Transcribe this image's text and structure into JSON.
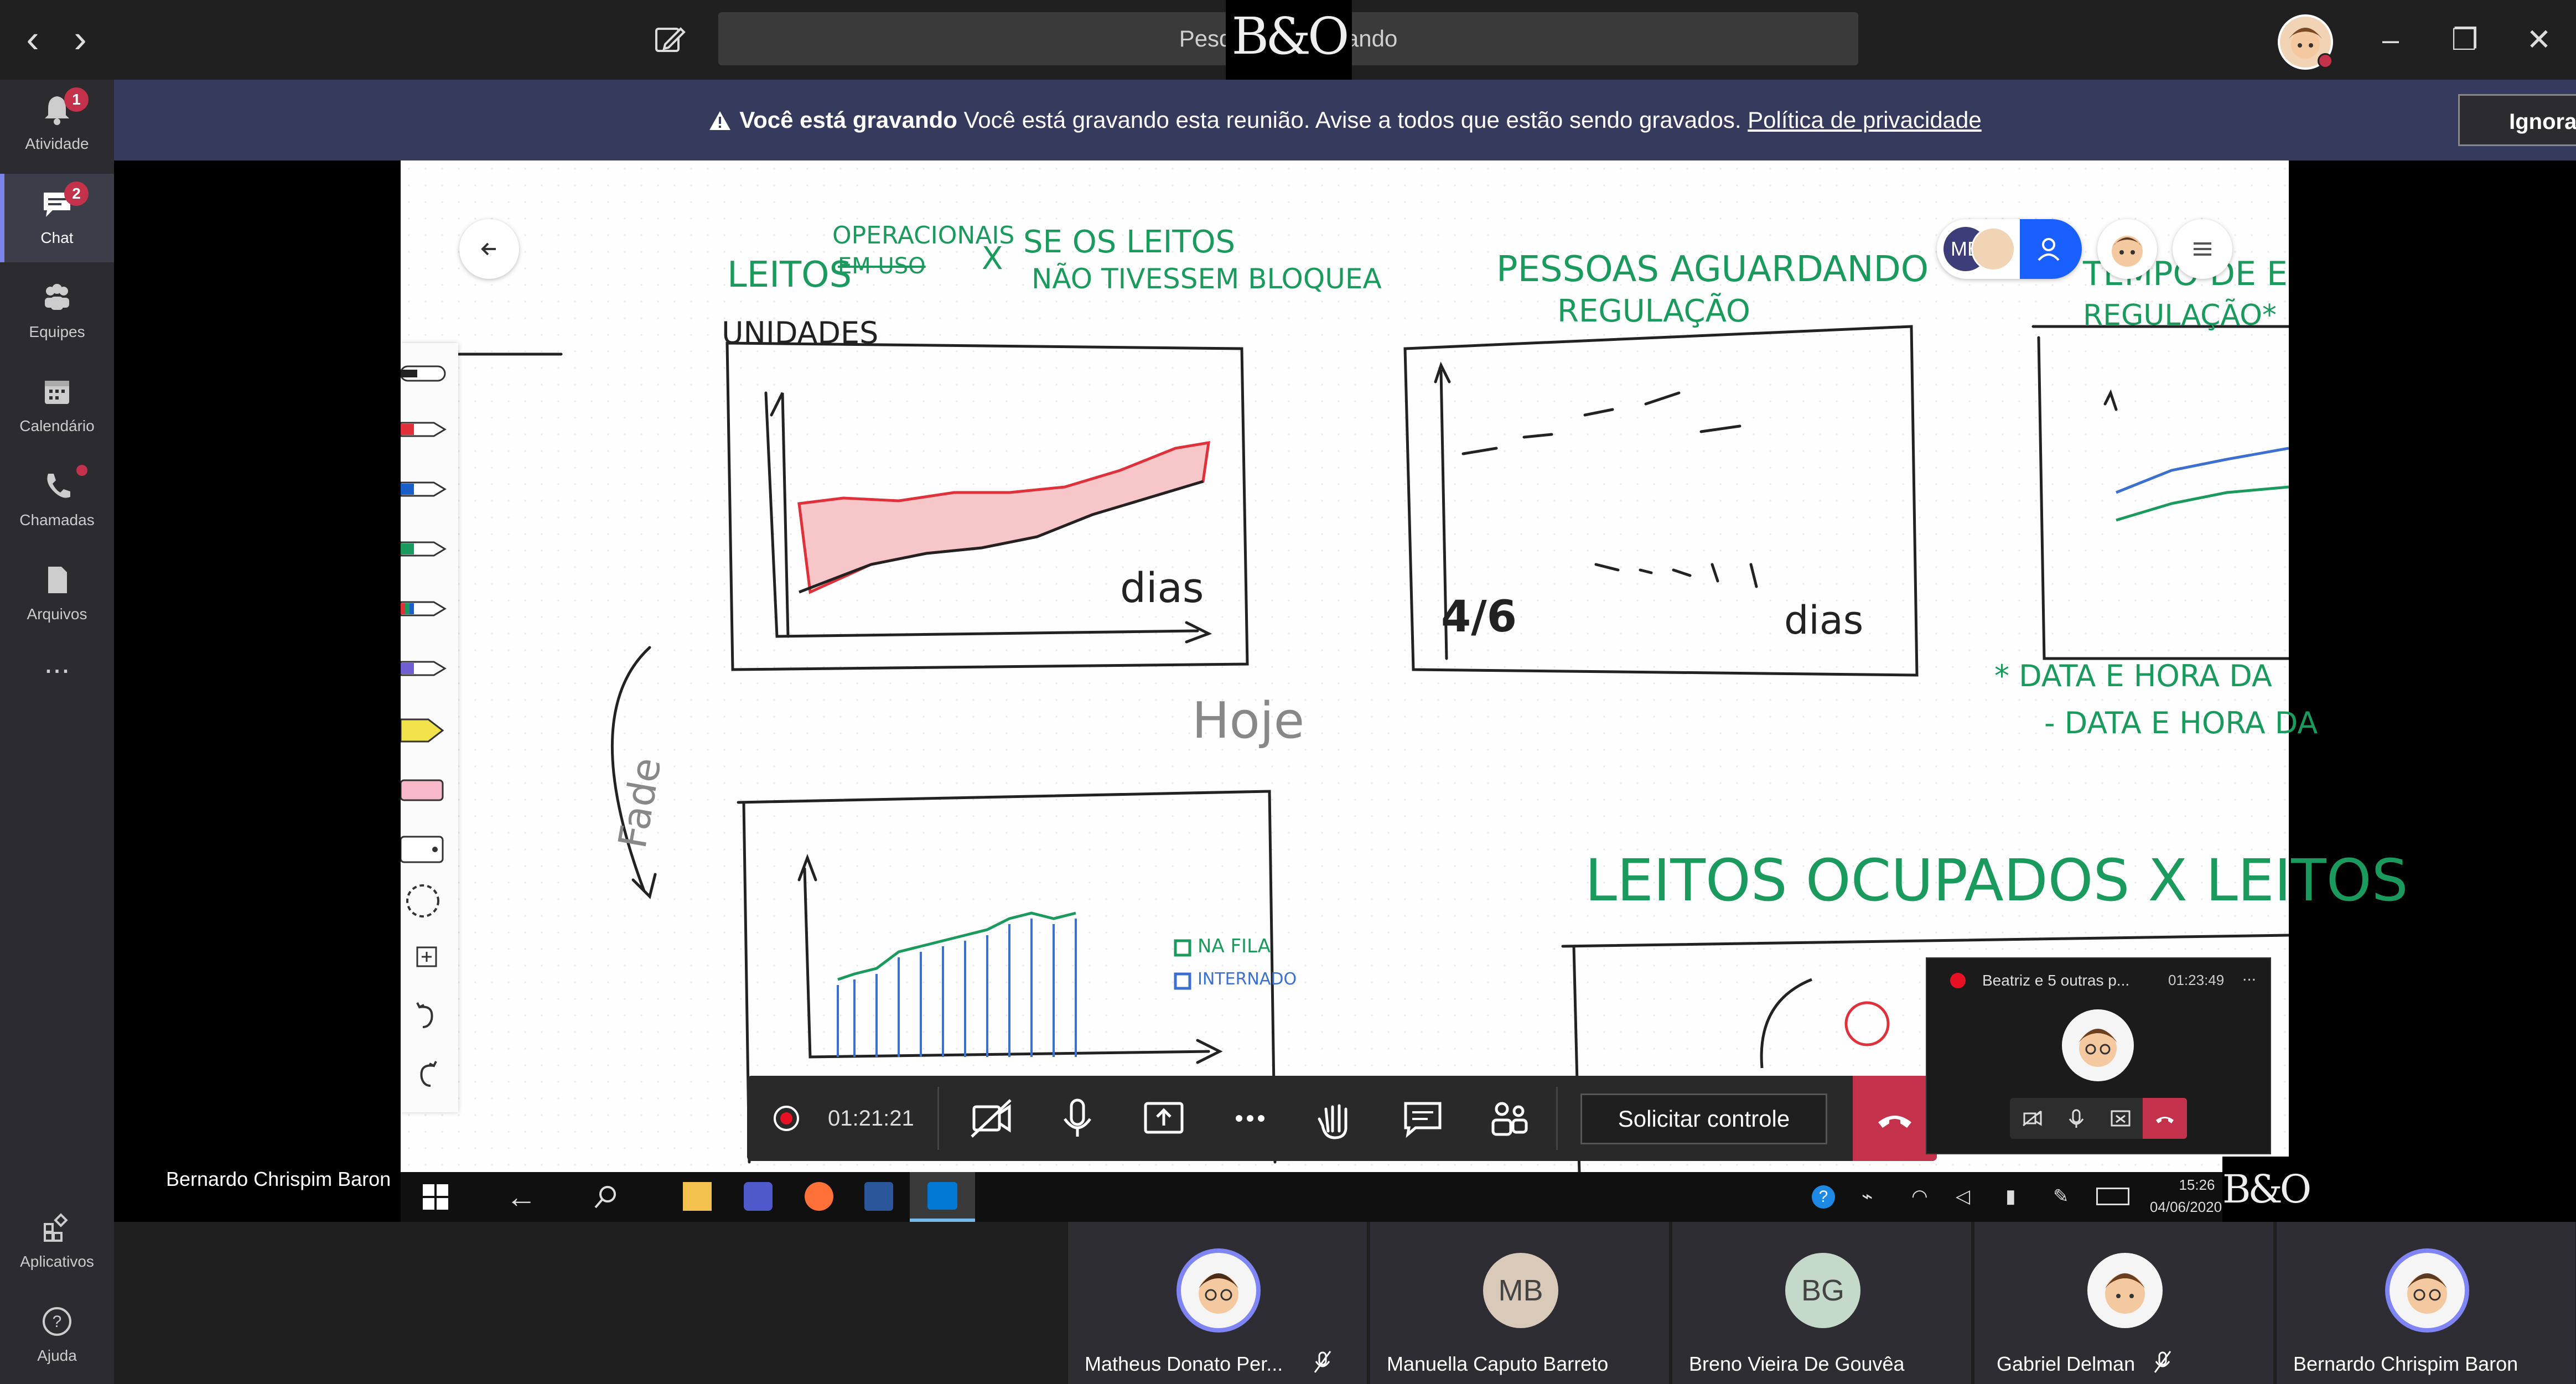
{
  "titlebar": {
    "search_placeholder": "Pesquise ou digite um comando",
    "search_visible": "Pesquise ou                     omando",
    "bo_logo": "B&O"
  },
  "sidebar": {
    "items": [
      {
        "label": "Atividade",
        "badge": "1",
        "icon": "bell-icon"
      },
      {
        "label": "Chat",
        "badge": "2",
        "icon": "chat-icon",
        "active": true
      },
      {
        "label": "Equipes",
        "icon": "teams-icon"
      },
      {
        "label": "Calendário",
        "icon": "calendar-icon"
      },
      {
        "label": "Chamadas",
        "icon": "phone-icon",
        "dot": true
      },
      {
        "label": "Arquivos",
        "icon": "files-icon"
      },
      {
        "label": "...",
        "icon": "more-icon"
      },
      {
        "label": "Aplicativos",
        "icon": "apps-icon"
      },
      {
        "label": "Ajuda",
        "icon": "help-icon"
      }
    ]
  },
  "banner": {
    "bold": "Você está gravando",
    "text": " Você está gravando esta reunião. Avise a todos que estão sendo gravados. ",
    "link": "Política de privacidade",
    "ignore": "Ignorar"
  },
  "whiteboard": {
    "notes": [
      "LEITOS",
      "OPERACIONAIS",
      "EM USO",
      "X",
      "SE OS LEITOS",
      "NÃO TIVESSEM BLOQUEA",
      "PESSOAS AGUARDANDO",
      "REGULAÇÃO",
      "TEMPO DE E",
      "REGULAÇÃO*",
      "UNIDADES",
      "dias",
      "4/6",
      "dias",
      "Hoje",
      "Fade",
      "* DATA E HORA DA",
      "- DATA E HORA DA",
      "LEITOS OCUPADOS X LEITOS",
      "NA FILA",
      "INTERNADO"
    ],
    "collab_initials": "MB"
  },
  "shared_by": "Bernardo Chrispim Baron",
  "controls": {
    "timer": "01:21:21",
    "request_control": "Solicitar controle"
  },
  "mini_call": {
    "title": "Beatriz e 5 outras p...",
    "time": "01:23:49",
    "more": "..."
  },
  "taskbar": {
    "time": "15:26",
    "date": "04/06/2020"
  },
  "participants": [
    {
      "name": "Matheus Donato Per...",
      "initials": "",
      "avatar": "photo",
      "muted": true,
      "speaking": true,
      "color": "#f5f5f5"
    },
    {
      "name": "Manuella Caputo Barreto",
      "initials": "MB",
      "avatar": "initials",
      "muted": false,
      "color": "#d9c9b9"
    },
    {
      "name": "Breno Vieira De Gouvêa",
      "initials": "BG",
      "avatar": "initials",
      "muted": false,
      "color": "#c4d9c9"
    },
    {
      "name": "Gabriel Delman",
      "initials": "",
      "avatar": "photo",
      "muted": true,
      "color": "#f5f5f5"
    },
    {
      "name": "Bernardo Chrispim Baron",
      "initials": "",
      "avatar": "photo",
      "muted": false,
      "speaking": true,
      "color": "#f5f5f5"
    }
  ],
  "colors": {
    "accent": "#7b83eb",
    "banner": "#363b5e",
    "hangup": "#c4314b",
    "green_ink": "#1a9a5c",
    "red_ink": "#e0303a",
    "blue_ink": "#3b6fd0"
  }
}
